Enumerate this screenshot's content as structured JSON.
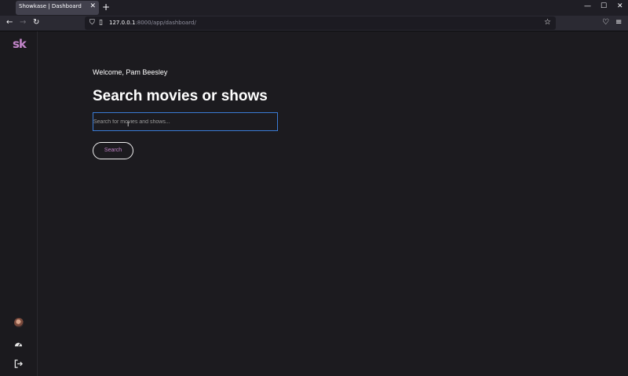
{
  "browser": {
    "tab_title": "Showkase | Dashboard",
    "tab_close_icon": "close-icon",
    "new_tab_label": "+",
    "url_host": "127.0.0.1",
    "url_rest": ":8000/app/dashboard/",
    "window_controls": [
      "minimize-icon",
      "maximize-icon",
      "close-icon"
    ]
  },
  "sidebar": {
    "logo": "sk",
    "items": [
      {
        "name": "avatar",
        "icon": "user-avatar-icon"
      },
      {
        "name": "dashboard",
        "icon": "speedometer-icon"
      },
      {
        "name": "logout",
        "icon": "logout-icon"
      }
    ]
  },
  "main": {
    "welcome": "Welcome, Pam Beesley",
    "heading": "Search movies or shows",
    "search_placeholder": "Search for movies and shows...",
    "search_button": "Search"
  },
  "colors": {
    "accent": "#c285c9",
    "background": "#1c1b1f",
    "focus": "#3a7bd5"
  }
}
